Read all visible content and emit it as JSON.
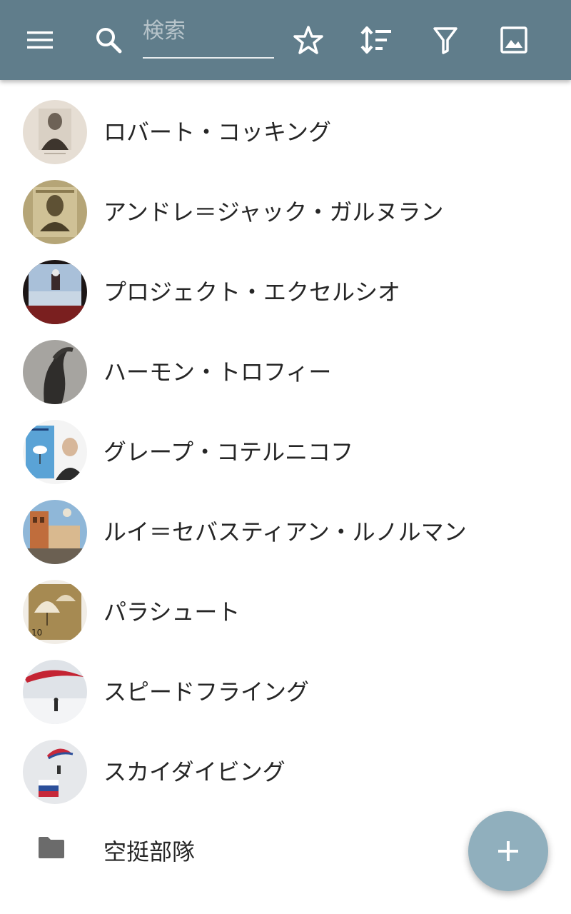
{
  "toolbar": {
    "search_placeholder": "検索",
    "search_value": "",
    "icons": [
      "menu-icon",
      "search-icon",
      "star-outline-icon",
      "sort-icon",
      "filter-icon",
      "image-icon"
    ]
  },
  "items": [
    {
      "label": "ロバート・コッキング",
      "type": "article"
    },
    {
      "label": "アンドレ＝ジャック・ガルヌラン",
      "type": "article"
    },
    {
      "label": "プロジェクト・エクセルシオ",
      "type": "article"
    },
    {
      "label": "ハーモン・トロフィー",
      "type": "article"
    },
    {
      "label": "グレープ・コテルニコフ",
      "type": "article"
    },
    {
      "label": "ルイ＝セバスティアン・ルノルマン",
      "type": "article"
    },
    {
      "label": "パラシュート",
      "type": "article"
    },
    {
      "label": "スピードフライング",
      "type": "article"
    },
    {
      "label": "スカイダイビング",
      "type": "article"
    },
    {
      "label": "空挺部隊",
      "type": "folder"
    }
  ],
  "fab": {
    "icon": "plus-icon"
  },
  "colors": {
    "toolbar": "#607d8b",
    "fab": "#90afbd",
    "text": "#262626",
    "folder": "#6b6b6b"
  }
}
